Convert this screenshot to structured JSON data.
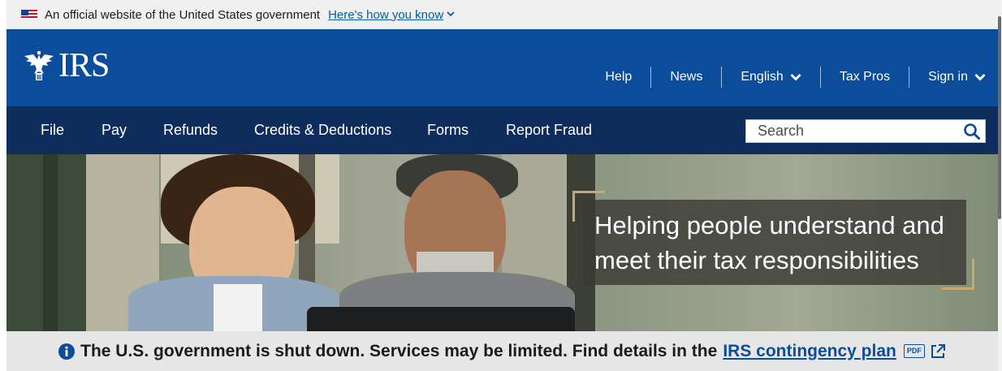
{
  "gov_banner": {
    "text": "An official website of the United States government",
    "link_label": "Here's how you know",
    "chevron_icon": "chevron-down-icon"
  },
  "header": {
    "logo_text": "IRS",
    "logo_icon": "irs-eagle-icon",
    "util_nav": [
      {
        "label": "Help"
      },
      {
        "label": "News"
      },
      {
        "label": "English",
        "icon": "chevron-down-icon"
      },
      {
        "label": "Tax Pros"
      },
      {
        "label": "Sign in",
        "icon": "chevron-down-icon"
      }
    ]
  },
  "main_nav": {
    "items": [
      {
        "label": "File"
      },
      {
        "label": "Pay"
      },
      {
        "label": "Refunds"
      },
      {
        "label": "Credits & Deductions"
      },
      {
        "label": "Forms"
      },
      {
        "label": "Report Fraud"
      }
    ],
    "search": {
      "placeholder": "Search",
      "value": "",
      "icon": "search-icon"
    }
  },
  "hero": {
    "caption_lines": [
      "Helping people understand and",
      "meet their tax responsibilities"
    ]
  },
  "alert": {
    "icon": "info-icon",
    "text": "The U.S. government is shut down. Services may be limited. Find details in the",
    "link_label": "IRS contingency plan",
    "pdf_label": "PDF",
    "external_icon": "external-link-icon"
  },
  "colors": {
    "header_blue": "#0b4c9b",
    "nav_navy": "#0f2d5c",
    "link_blue": "#005ea2",
    "accent_gold": "#c9a96e",
    "alert_bg": "#e6e6e6"
  }
}
